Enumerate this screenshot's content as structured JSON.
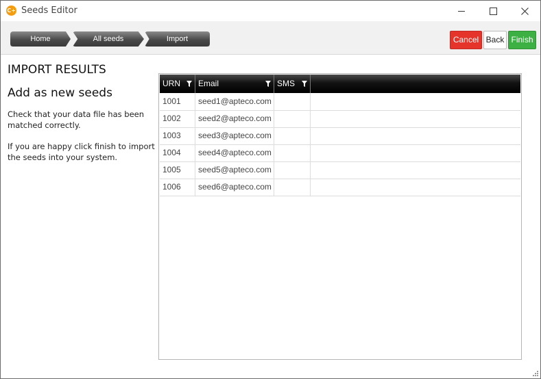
{
  "window": {
    "title": "Seeds Editor",
    "icon_text": "C+",
    "icon_color": "#f39c12"
  },
  "breadcrumbs": [
    {
      "label": "Home"
    },
    {
      "label": "All seeds"
    },
    {
      "label": "Import"
    }
  ],
  "actions": {
    "cancel_label": "Cancel",
    "back_label": "Back",
    "finish_label": "Finish"
  },
  "colors": {
    "cancel": "#e5342a",
    "finish": "#3cb043"
  },
  "panel": {
    "heading": "IMPORT RESULTS",
    "subheading": "Add as new seeds",
    "paragraph1": "Check that your data file has been matched correctly.",
    "paragraph2": "If you are happy click finish to import the seeds into your system."
  },
  "grid": {
    "columns": [
      "URN",
      "Email",
      "SMS"
    ],
    "rows": [
      {
        "urn": "1001",
        "email": "seed1@apteco.com",
        "sms": ""
      },
      {
        "urn": "1002",
        "email": "seed2@apteco.com",
        "sms": ""
      },
      {
        "urn": "1003",
        "email": "seed3@apteco.com",
        "sms": ""
      },
      {
        "urn": "1004",
        "email": "seed4@apteco.com",
        "sms": ""
      },
      {
        "urn": "1005",
        "email": "seed5@apteco.com",
        "sms": ""
      },
      {
        "urn": "1006",
        "email": "seed6@apteco.com",
        "sms": ""
      }
    ]
  }
}
